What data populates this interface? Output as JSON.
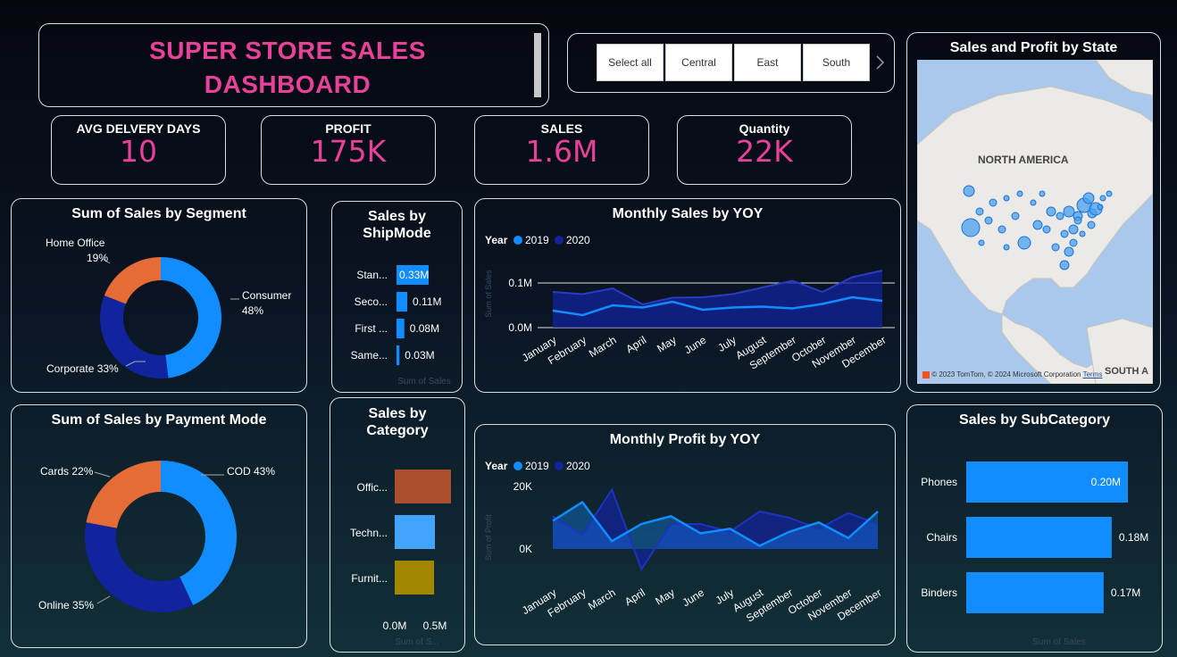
{
  "header": {
    "title_line1": "SUPER STORE SALES",
    "title_line2": "DASHBOARD"
  },
  "slicer": {
    "items": [
      "Select all",
      "Central",
      "East",
      "South"
    ]
  },
  "kpis": [
    {
      "label": "AVG DELVERY DAYS",
      "value": "10"
    },
    {
      "label": "PROFIT",
      "value": "175K"
    },
    {
      "label": "SALES",
      "value": "1.6M"
    },
    {
      "label": "Quantity",
      "value": "22K"
    }
  ],
  "map": {
    "title": "Sales and Profit by State",
    "region_label": "NORTH AMERICA",
    "south_label": "SOUTH A",
    "copyright": "© 2023 TomTom, © 2024 Microsoft Corporation",
    "terms": "Terms"
  },
  "segment": {
    "title": "Sum of Sales by Segment",
    "slices": [
      {
        "name": "Consumer",
        "pct": "48%",
        "value": 48,
        "color": "#118dff"
      },
      {
        "name": "Corporate",
        "pct": "33%",
        "value": 33,
        "color": "#12239e"
      },
      {
        "name": "Home Office",
        "pct": "19%",
        "value": 19,
        "color": "#e66c37"
      }
    ]
  },
  "payment": {
    "title": "Sum of Sales by Payment Mode",
    "slices": [
      {
        "name": "COD",
        "pct": "43%",
        "value": 43,
        "color": "#118dff"
      },
      {
        "name": "Online",
        "pct": "35%",
        "value": 35,
        "color": "#12239e"
      },
      {
        "name": "Cards",
        "pct": "22%",
        "value": 22,
        "color": "#e66c37"
      }
    ]
  },
  "shipmode": {
    "title_line1": "Sales by",
    "title_line2": "ShipMode",
    "axis_label": "Sum of Sales",
    "bars": [
      {
        "label": "Stan...",
        "value": 0.33,
        "text": "0.33M"
      },
      {
        "label": "Seco...",
        "value": 0.11,
        "text": "0.11M"
      },
      {
        "label": "First ...",
        "value": 0.08,
        "text": "0.08M"
      },
      {
        "label": "Same...",
        "value": 0.03,
        "text": "0.03M"
      }
    ]
  },
  "category": {
    "title_line1": "Sales by",
    "title_line2": "Category",
    "axis_label": "Sum of S...",
    "ticks": [
      "0.0M",
      "0.5M"
    ],
    "bars": [
      {
        "label": "Offic...",
        "value": 0.7,
        "color": "#a94f2e"
      },
      {
        "label": "Techn...",
        "value": 0.5,
        "color": "#41a4ff"
      },
      {
        "label": "Furnit...",
        "value": 0.49,
        "color": "#a38700"
      }
    ]
  },
  "months": [
    "January",
    "February",
    "March",
    "April",
    "May",
    "June",
    "July",
    "August",
    "September",
    "October",
    "November",
    "December"
  ],
  "legend": {
    "year_label": "Year",
    "y2019": "2019",
    "y2020": "2020",
    "c2019": "#118dff",
    "c2020": "#12239e"
  },
  "monthly_sales": {
    "title": "Monthly Sales by YOY",
    "y_axis_label": "Sum of Sales",
    "ticks": [
      "0.1M",
      "0.0M"
    ],
    "s2019": [
      0.038,
      0.028,
      0.05,
      0.045,
      0.058,
      0.04,
      0.045,
      0.047,
      0.043,
      0.053,
      0.068,
      0.06
    ],
    "s2020": [
      0.08,
      0.075,
      0.088,
      0.052,
      0.067,
      0.068,
      0.075,
      0.09,
      0.105,
      0.08,
      0.113,
      0.128
    ]
  },
  "monthly_profit": {
    "title": "Monthly Profit by YOY",
    "y_axis_label": "Sum of Profit",
    "ticks": [
      "20K",
      "0K"
    ],
    "p2019": [
      9000,
      15000,
      2500,
      8000,
      10500,
      5000,
      6500,
      1000,
      5500,
      8500,
      3500,
      12000
    ],
    "p2020": [
      10500,
      4500,
      19000,
      -6500,
      8000,
      8000,
      5500,
      12000,
      10000,
      6500,
      11500,
      8000
    ]
  },
  "subcategory": {
    "title": "Sales by SubCategory",
    "axis_label": "Sum of Sales",
    "bars": [
      {
        "label": "Phones",
        "value": 0.2,
        "text": "0.20M"
      },
      {
        "label": "Chairs",
        "value": 0.18,
        "text": "0.18M"
      },
      {
        "label": "Binders",
        "value": 0.17,
        "text": "0.17M"
      }
    ]
  }
}
